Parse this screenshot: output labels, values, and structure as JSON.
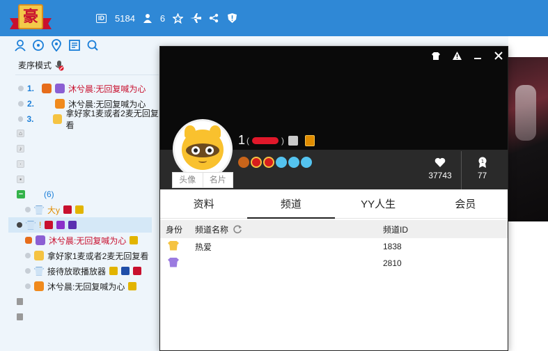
{
  "topbar": {
    "logo_text": "豪",
    "channel_id_label": "ID",
    "channel_id": "5184",
    "online_count": "6",
    "icons": [
      "user-icon",
      "star-icon",
      "plane-icon",
      "share-icon",
      "shield-icon"
    ]
  },
  "left": {
    "toolbar_icons": [
      "user-outline-icon",
      "chat-icon",
      "location-icon",
      "list-icon",
      "search-icon"
    ],
    "mic_mode_label": "麦序模式",
    "queue": [
      {
        "num": "1.",
        "name": "沐兮晨:无回复喊为心",
        "red": true
      },
      {
        "num": "2.",
        "name": "沐兮晨:无回复喊为心",
        "red": false
      },
      {
        "num": "3.",
        "name": "拿好家1麦或者2麦无回复看",
        "red": false
      }
    ],
    "channel_count": "(6)",
    "users": [
      {
        "name": "大y",
        "red": false
      },
      {
        "name": "!",
        "red": false
      },
      {
        "name": "沐兮晨:无回复喊为心",
        "red": true
      },
      {
        "name": "拿好家1麦或者2麦无回复看",
        "red": false
      },
      {
        "name": "接待放歌播放器",
        "red": false
      },
      {
        "name": "沐兮晨:无回复喊为心",
        "red": false
      }
    ]
  },
  "popup": {
    "nickname_prefix": "1",
    "avatar_tab": "头像",
    "card_tab": "名片",
    "likes": "37743",
    "rank": "77",
    "tabs": [
      "资料",
      "频道",
      "YY人生",
      "会员"
    ],
    "active_tab": "频道",
    "table_headers": {
      "role": "身份",
      "name": "频道名称",
      "id": "频道ID"
    },
    "rows": [
      {
        "name": "热爱",
        "id": "1838",
        "role_color": "#f5c342"
      },
      {
        "name": "",
        "id": "2810",
        "role_color": "#9b7be0"
      }
    ]
  }
}
